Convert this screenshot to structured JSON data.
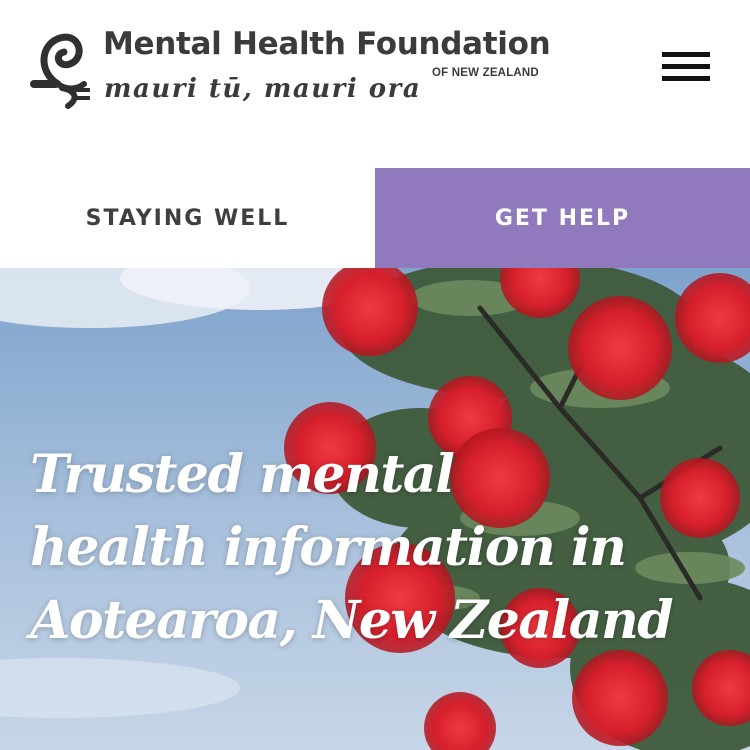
{
  "header": {
    "logo_icon": "koru-swirl-icon",
    "org_name": "Mental Health Foundation",
    "org_country": "OF NEW ZEALAND",
    "tagline": "mauri tū, mauri ora",
    "menu_icon": "hamburger-menu-icon"
  },
  "nav": {
    "tabs": [
      {
        "label": "STAYING WELL",
        "active": false
      },
      {
        "label": "GET HELP",
        "active": true
      }
    ]
  },
  "hero": {
    "heading_line1": "Trusted mental",
    "heading_line2": "health information in",
    "heading_line3": "Aotearoa, New Zealand",
    "image": "pohutukawa-flowers-against-sky"
  },
  "colors": {
    "accent_purple": "#9079bd",
    "text_dark": "#3a3b3d",
    "flower_red": "#d8232f",
    "sky_blue": "#9cb7d6"
  }
}
